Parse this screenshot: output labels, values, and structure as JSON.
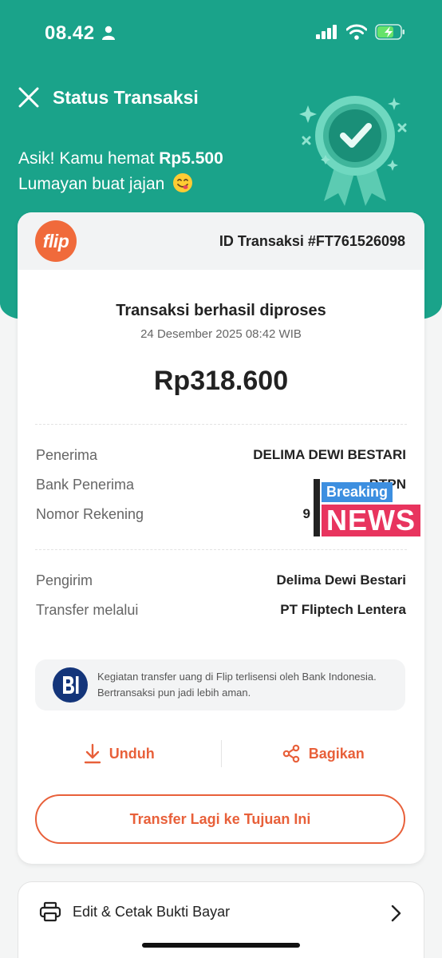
{
  "status_bar": {
    "time": "08.42"
  },
  "header": {
    "title": "Status Transaksi",
    "save_prefix": "Asik! Kamu hemat ",
    "save_amount": "Rp5.500",
    "save_line2": "Lumayan buat jajan"
  },
  "card": {
    "logo_text": "flip",
    "transaction_id": "ID Transaksi #FT761526098",
    "result_title": "Transaksi berhasil diproses",
    "result_date": "24 Desember 2025 08:42 WIB",
    "amount": "Rp318.600",
    "recipient_rows": [
      {
        "label": "Penerima",
        "value": "DELIMA DEWI BESTARI"
      },
      {
        "label": "Bank Penerima",
        "value": "BTPN"
      },
      {
        "label": "Nomor Rekening",
        "value": "9"
      }
    ],
    "sender_rows": [
      {
        "label": "Pengirim",
        "value": "Delima Dewi Bestari"
      },
      {
        "label": "Transfer melalui",
        "value": "PT Fliptech Lentera"
      }
    ],
    "bi_notice_line1": "Kegiatan transfer uang di Flip terlisensi oleh Bank Indonesia.",
    "bi_notice_line2": "Bertransaksi pun jadi lebih aman.",
    "download_label": "Unduh",
    "share_label": "Bagikan",
    "transfer_again_label": "Transfer Lagi ke Tujuan Ini"
  },
  "edit_card": {
    "label": "Edit & Cetak Bukti Bayar"
  },
  "overlay": {
    "breaking": "Breaking",
    "news": "NEWS"
  },
  "colors": {
    "brand_green": "#1aa38a",
    "accent_orange": "#e8603a",
    "flip_logo": "#f06a3b",
    "bi_blue": "#14357a"
  }
}
